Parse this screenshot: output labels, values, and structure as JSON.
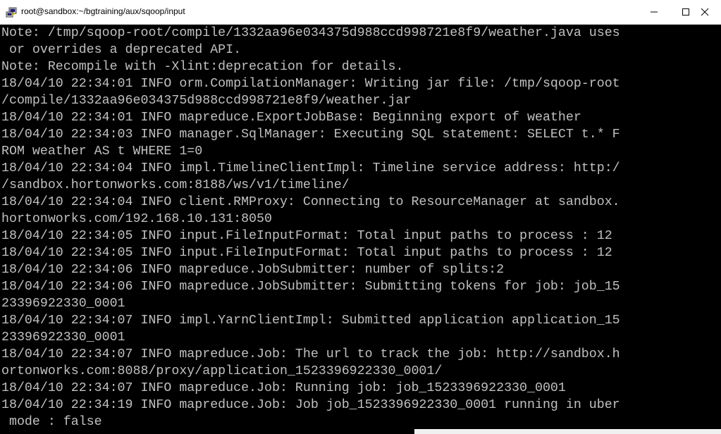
{
  "window": {
    "title": "root@sandbox:~/bgtraining/aux/sqoop/input",
    "app_icon": "putty-icon",
    "controls": {
      "minimize_icon": "minimize-icon",
      "maximize_icon": "maximize-icon",
      "close_icon": "close-icon"
    }
  },
  "colors": {
    "terminal_bg": "#000000",
    "terminal_fg": "#c0c0c0",
    "titlebar_bg": "#ffffff"
  },
  "terminal": {
    "lines": [
      "Note: /tmp/sqoop-root/compile/1332aa96e034375d988ccd998721e8f9/weather.java uses",
      " or overrides a deprecated API.",
      "Note: Recompile with -Xlint:deprecation for details.",
      "18/04/10 22:34:01 INFO orm.CompilationManager: Writing jar file: /tmp/sqoop-root",
      "/compile/1332aa96e034375d988ccd998721e8f9/weather.jar",
      "18/04/10 22:34:01 INFO mapreduce.ExportJobBase: Beginning export of weather",
      "18/04/10 22:34:03 INFO manager.SqlManager: Executing SQL statement: SELECT t.* F",
      "ROM weather AS t WHERE 1=0",
      "18/04/10 22:34:04 INFO impl.TimelineClientImpl: Timeline service address: http:/",
      "/sandbox.hortonworks.com:8188/ws/v1/timeline/",
      "18/04/10 22:34:04 INFO client.RMProxy: Connecting to ResourceManager at sandbox.",
      "hortonworks.com/192.168.10.131:8050",
      "18/04/10 22:34:05 INFO input.FileInputFormat: Total input paths to process : 12",
      "18/04/10 22:34:05 INFO input.FileInputFormat: Total input paths to process : 12",
      "18/04/10 22:34:06 INFO mapreduce.JobSubmitter: number of splits:2",
      "18/04/10 22:34:06 INFO mapreduce.JobSubmitter: Submitting tokens for job: job_15",
      "23396922330_0001",
      "18/04/10 22:34:07 INFO impl.YarnClientImpl: Submitted application application_15",
      "23396922330_0001",
      "18/04/10 22:34:07 INFO mapreduce.Job: The url to track the job: http://sandbox.h",
      "ortonworks.com:8088/proxy/application_1523396922330_0001/",
      "18/04/10 22:34:07 INFO mapreduce.Job: Running job: job_1523396922330_0001",
      "18/04/10 22:34:19 INFO mapreduce.Job: Job job_1523396922330_0001 running in uber",
      " mode : false"
    ]
  }
}
